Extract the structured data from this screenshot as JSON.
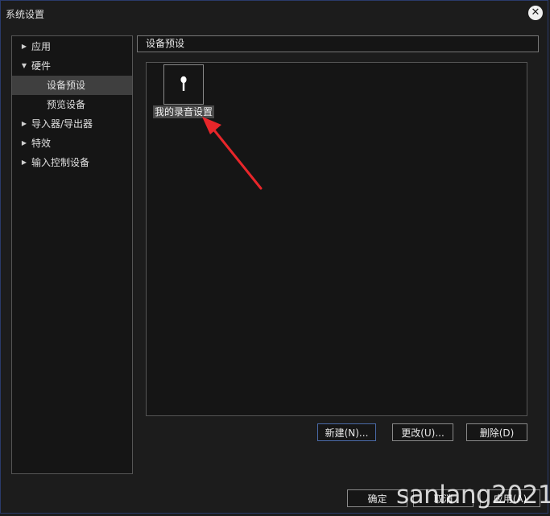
{
  "window": {
    "title": "系统设置"
  },
  "sidebar": {
    "items": [
      {
        "label": "应用",
        "arrow": "▶"
      },
      {
        "label": "硬件",
        "arrow": "▼"
      },
      {
        "label": "设备预设",
        "arrow": ""
      },
      {
        "label": "预览设备",
        "arrow": ""
      },
      {
        "label": "导入器/导出器",
        "arrow": "▶"
      },
      {
        "label": "特效",
        "arrow": "▶"
      },
      {
        "label": "输入控制设备",
        "arrow": "▶"
      }
    ]
  },
  "header": {
    "title": "设备预设"
  },
  "presets": [
    {
      "label": "我的录音设置",
      "icon": "microphone-icon"
    }
  ],
  "actions": {
    "new": "新建(N)...",
    "change": "更改(U)...",
    "delete": "删除(D)"
  },
  "footer": {
    "ok": "确定",
    "cancel": "取消",
    "apply": "应用(A)"
  },
  "watermark": "sanlang2021",
  "colors": {
    "annotation_arrow": "#e8262a",
    "primary_border": "#4a6aa8"
  }
}
